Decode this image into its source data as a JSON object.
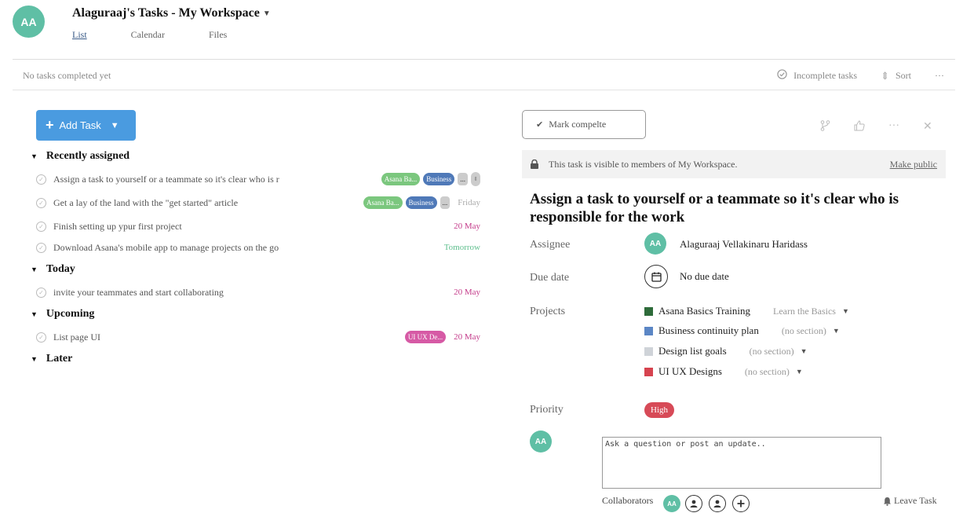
{
  "header": {
    "avatar_initials": "AA",
    "workspace_title": "Alaguraaj's Tasks - My Workspace",
    "tabs": [
      {
        "label": "List",
        "active": true
      },
      {
        "label": "Calendar",
        "active": false
      },
      {
        "label": "Files",
        "active": false
      }
    ]
  },
  "toolbar": {
    "status_text": "No tasks completed yet",
    "filter_label": "Incomplete tasks",
    "sort_label": "Sort",
    "more_label": "···"
  },
  "task_list": {
    "add_task_label": "Add Task",
    "sections": [
      {
        "title": "Recently assigned"
      },
      {
        "title": "Today"
      },
      {
        "title": "Upcoming"
      },
      {
        "title": "Later"
      }
    ],
    "tasks": [
      {
        "name": "Assign a task to yourself or a teammate so it's clear who is r",
        "tags": [
          "Asana Ba...",
          "Business"
        ],
        "more": "...",
        "due": ""
      },
      {
        "name": "Get a lay of the land with the \"get started\" article",
        "tags": [
          "Asana Ba...",
          "Business"
        ],
        "more": "...",
        "due": "Friday"
      },
      {
        "name": "Finish setting up ypur first project",
        "due": "20 May"
      },
      {
        "name": "Download Asana's mobile app to manage projects on the go",
        "due": "Tomorrow"
      },
      {
        "name": "invite your teammates and start collaborating",
        "due": "20 May"
      },
      {
        "name": "List page UI",
        "tags": [
          "UI UX De..."
        ],
        "due": "20 May"
      }
    ]
  },
  "detail": {
    "mark_complete_label": "Mark compelte",
    "visibility_text": "This task is visible to members of My Workspace.",
    "make_public_label": "Make public",
    "title": "Assign a task to yourself or a teammate so it's clear who is responsible for the work",
    "labels": {
      "assignee": "Assignee",
      "due_date": "Due date",
      "projects": "Projects",
      "priority": "Priority"
    },
    "assignee": {
      "initials": "AA",
      "name": "Alaguraaj Vellakinaru Haridass"
    },
    "due_date_text": "No due date",
    "projects": [
      {
        "name": "Asana Basics Training",
        "section": "Learn the Basics",
        "color": "#2e6b3a"
      },
      {
        "name": "Business continuity plan",
        "section": "(no section)",
        "color": "#5b86c5"
      },
      {
        "name": "Design list goals",
        "section": "(no section)",
        "color": "#cfd3d8"
      },
      {
        "name": "UI UX Designs",
        "section": "(no section)",
        "color": "#d6434f"
      }
    ],
    "priority": "High",
    "comment": {
      "avatar_initials": "AA",
      "placeholder": "Ask a question or post an update.."
    },
    "collaborators_label": "Collaborators",
    "collaborator_initials": "AA",
    "leave_task_label": "Leave Task"
  }
}
